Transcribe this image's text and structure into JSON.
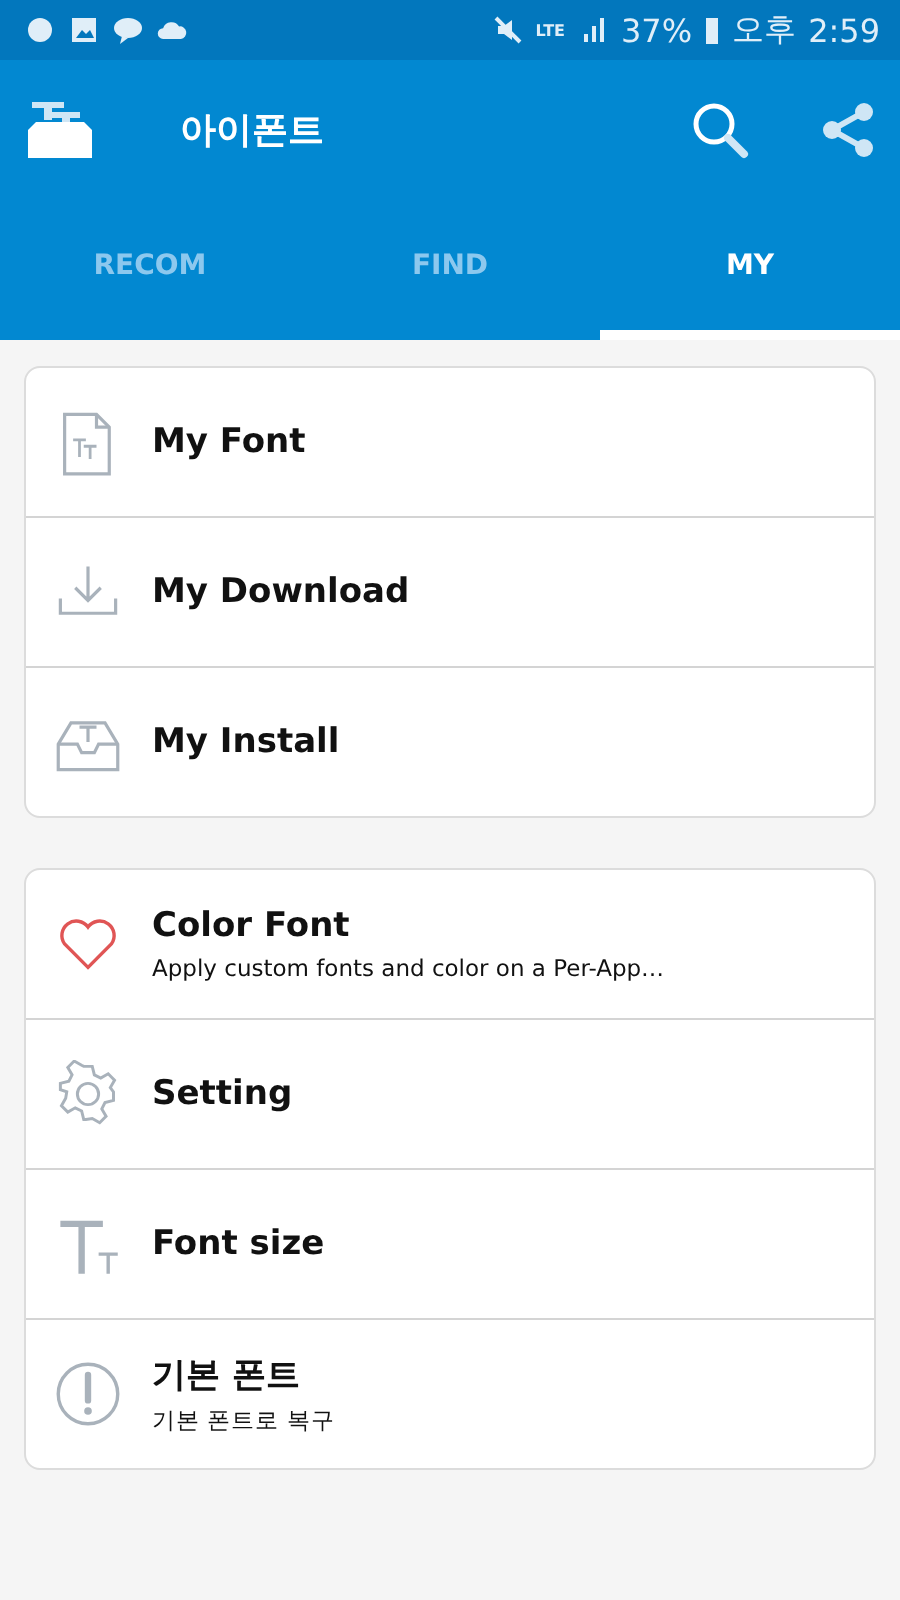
{
  "status_bar": {
    "network": "LTE",
    "battery": "37%",
    "period": "오후",
    "time": "2:59"
  },
  "app_bar": {
    "title": "아이폰트"
  },
  "tabs": [
    {
      "label": "RECOM",
      "selected": false
    },
    {
      "label": "FIND",
      "selected": false
    },
    {
      "label": "MY",
      "selected": true
    }
  ],
  "sections": [
    {
      "items": [
        {
          "kind": "font-file",
          "title": "My Font"
        },
        {
          "kind": "download",
          "title": "My Download"
        },
        {
          "kind": "tray",
          "title": "My Install"
        }
      ]
    },
    {
      "items": [
        {
          "kind": "heart",
          "title": "Color Font",
          "subtitle": "Apply custom fonts and color on a Per-App…"
        },
        {
          "kind": "gear",
          "title": "Setting"
        },
        {
          "kind": "size",
          "title": "Font size"
        },
        {
          "kind": "alert",
          "title": "기본 폰트",
          "subtitle": "기본 폰트로 복구"
        }
      ]
    }
  ]
}
